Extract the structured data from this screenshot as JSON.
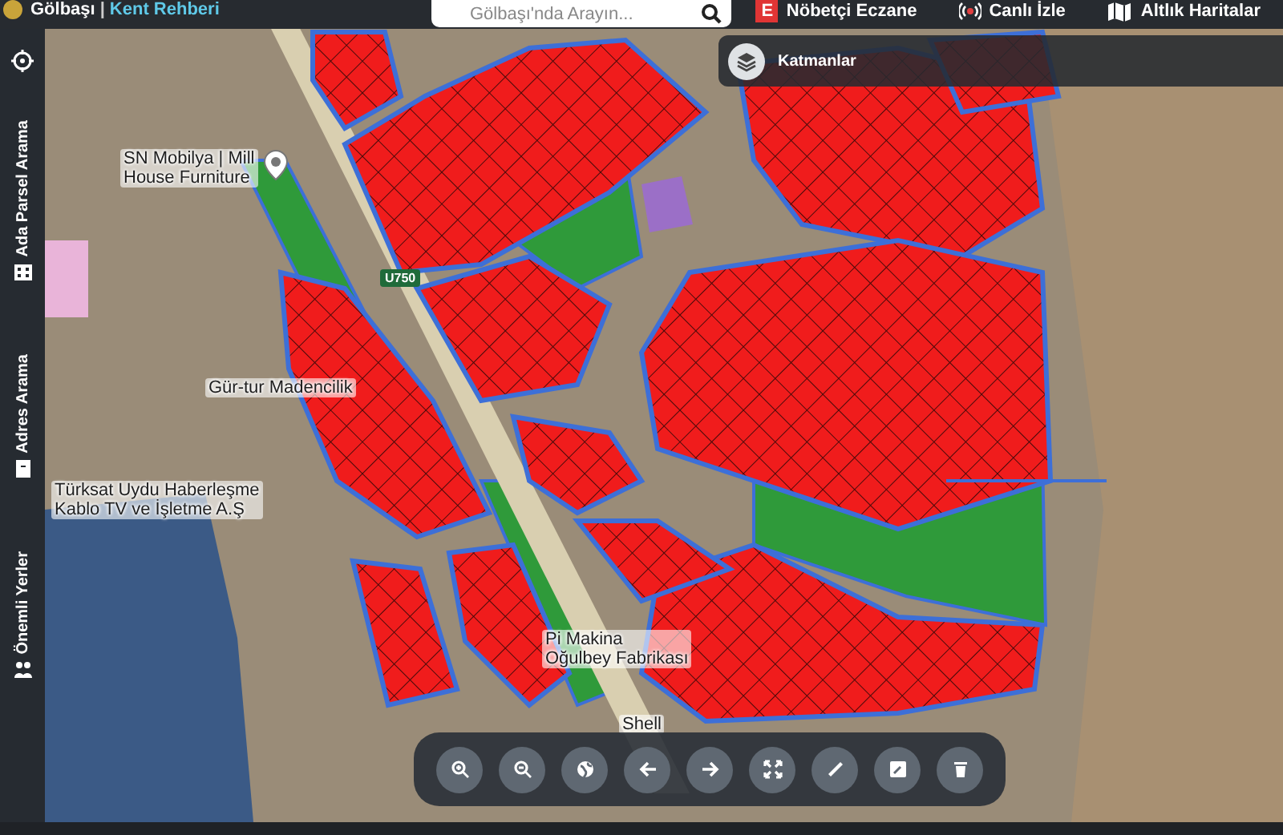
{
  "header": {
    "brand": "Gölbaşı",
    "separator": "|",
    "subtitle": "Kent Rehberi",
    "search": {
      "placeholder": "Gölbaşı'nda Arayın..."
    },
    "links": [
      {
        "kind": "pharmacy",
        "badge": "E",
        "label": "Nöbetçi Eczane"
      },
      {
        "kind": "live",
        "label": "Canlı İzle"
      },
      {
        "kind": "basemap",
        "label": "Altlık Haritalar"
      }
    ]
  },
  "sidebar": {
    "items": [
      {
        "kind": "parcel",
        "label": "Ada Parsel Arama"
      },
      {
        "kind": "address",
        "label": "Adres Arama"
      },
      {
        "kind": "places",
        "label": "Önemli Yerler"
      }
    ]
  },
  "layers_panel": {
    "title": "Katmanlar"
  },
  "map": {
    "road_shield": "U750",
    "labels": [
      {
        "kind": "pin",
        "lines": [
          "SN Mobilya | Mill",
          "House Furniture"
        ]
      },
      {
        "kind": "plain",
        "lines": [
          "Gür-tur Madencilik"
        ]
      },
      {
        "kind": "plain",
        "lines": [
          "Türksat Uydu Haberleşme",
          "Kablo TV ve İşletme A.Ş"
        ]
      },
      {
        "kind": "plain",
        "lines": [
          "Pi Makina",
          "Oğulbey Fabrikası"
        ]
      },
      {
        "kind": "plain",
        "lines": [
          "Shell"
        ]
      }
    ]
  },
  "toolbar": {
    "tools": [
      {
        "kind": "zoom-in"
      },
      {
        "kind": "zoom-out"
      },
      {
        "kind": "globe"
      },
      {
        "kind": "back"
      },
      {
        "kind": "forward"
      },
      {
        "kind": "fullscreen"
      },
      {
        "kind": "ruler"
      },
      {
        "kind": "edit"
      },
      {
        "kind": "delete"
      }
    ]
  }
}
